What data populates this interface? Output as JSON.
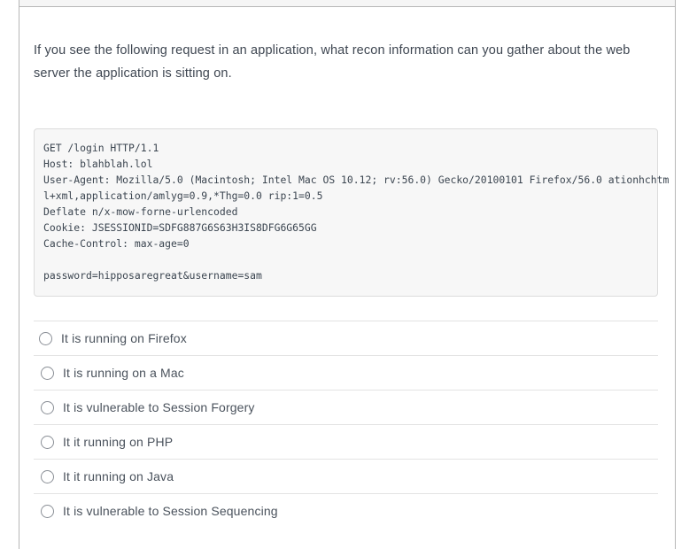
{
  "card": {
    "header_strip": "quiz-card-header"
  },
  "question": {
    "text": "If you see the following request in an application, what recon information can you gather about the web server the application is sitting on."
  },
  "request_block": {
    "lines": [
      "GET /login HTTP/1.1",
      "Host: blahblah.lol",
      "User-Agent: Mozilla/5.0 (Macintosh; Intel Mac OS 10.12; rv:56.0) Gecko/20100101 Firefox/56.0 ationhchtm",
      "l+xml,application/amlyg=0.9,*Thg=0.0 rip:1=0.5",
      "Deflate n/x-mow-forne-urlencoded",
      "Cookie: JSESSIONID=SDFG887G6S63H3IS8DFG6G65GG",
      "Cache-Control: max-age=0",
      "",
      "password=hipposaregreat&username=sam"
    ]
  },
  "answers": {
    "options": [
      {
        "label": "It is running on Firefox",
        "selected": false
      },
      {
        "label": "It is running on a Mac",
        "selected": false
      },
      {
        "label": "It is vulnerable to Session Forgery",
        "selected": false
      },
      {
        "label": "It it running on PHP",
        "selected": false
      },
      {
        "label": "It it running on Java",
        "selected": false
      },
      {
        "label": "It is vulnerable to Session Sequencing",
        "selected": false
      }
    ]
  },
  "colors": {
    "text": "#3e4651",
    "code_text": "#3b4550",
    "code_bg": "#f7f7f7",
    "code_border": "#dcdcdc",
    "card_border": "#b7b7b7",
    "separator": "#e3e3e3",
    "radio_border": "#8a8f96"
  }
}
